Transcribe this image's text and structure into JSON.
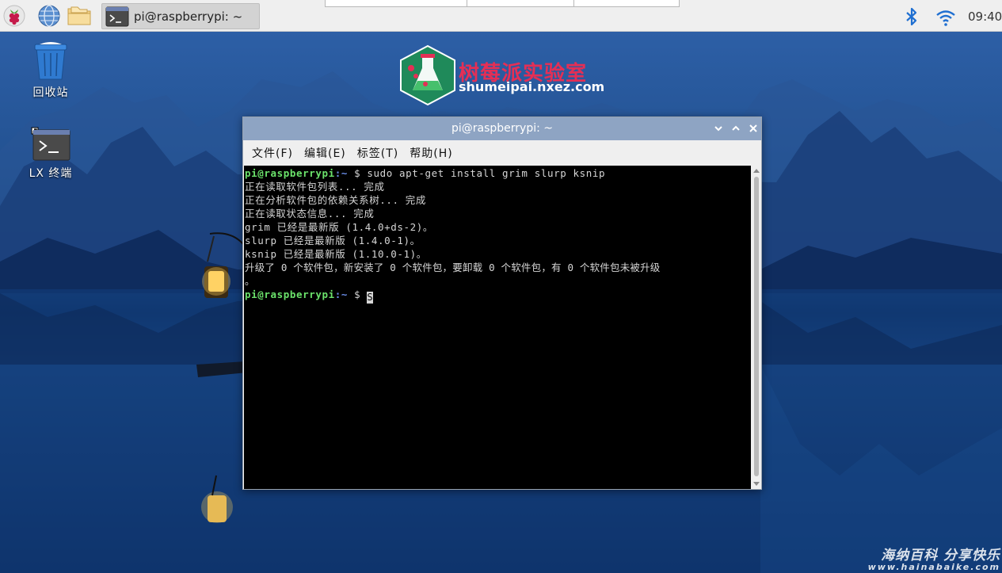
{
  "taskbar": {
    "task_title": "pi@raspberrypi: ~",
    "clock": "09:40",
    "icons": {
      "menu": "raspberry-icon",
      "browser": "globe-icon",
      "files": "folder-icon",
      "bluetooth": "bluetooth-icon",
      "network": "wifi-icon"
    }
  },
  "desktop": {
    "trash_label": "回收站",
    "terminal_label": "LX 终端"
  },
  "logo": {
    "title": "树莓派实验室",
    "subtitle": "shumeipai.nxez.com"
  },
  "terminal": {
    "title": "pi@raspberrypi: ~",
    "menus": [
      "文件(F)",
      "编辑(E)",
      "标签(T)",
      "帮助(H)"
    ],
    "prompt_user": "pi@raspberrypi",
    "prompt_path": ":~",
    "prompt_symbol": " $ ",
    "command": "sudo apt-get install grim slurp ksnip",
    "output": [
      "正在读取软件包列表... 完成",
      "正在分析软件包的依赖关系树... 完成",
      "正在读取状态信息... 完成",
      "grim 已经是最新版 (1.4.0+ds-2)。",
      "slurp 已经是最新版 (1.4.0-1)。",
      "ksnip 已经是最新版 (1.10.0-1)。",
      "升级了 0 个软件包，新安装了 0 个软件包，要卸载 0 个软件包，有 0 个软件包未被升级",
      "。"
    ],
    "cursor_char": "S"
  },
  "watermark": {
    "text": "海纳百科 分享快乐",
    "url": "www.hainabaike.com"
  },
  "colors": {
    "titlebar": "#8ea4c3",
    "prompt_user": "#6be26b",
    "prompt_path": "#6a8de8",
    "logo_red": "#e42f55",
    "panel": "#efefef"
  }
}
